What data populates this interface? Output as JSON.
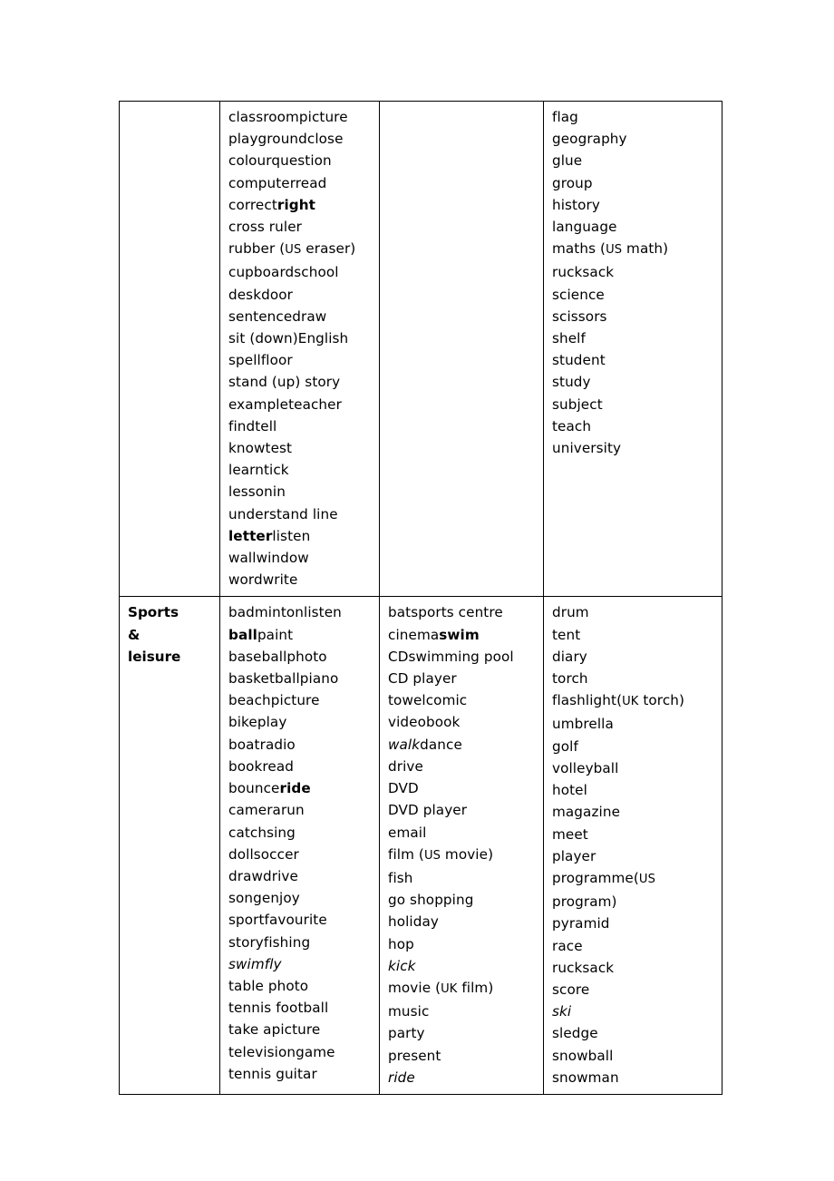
{
  "document": {
    "type": "vocabulary-reference-table",
    "page_background": "#ffffff",
    "text_color": "#000000",
    "border_color": "#000000"
  },
  "table": {
    "columns": 4,
    "rows": [
      {
        "row_id": "row-1-unnamed-category",
        "category": "",
        "col1_words": [],
        "col2_words": [
          {
            "text": "classroompicture",
            "style": "regular"
          },
          {
            "text": "playgroundclose",
            "style": "regular"
          },
          {
            "text": "colourquestion",
            "style": "regular"
          },
          {
            "text": "computerread",
            "style": "regular"
          },
          {
            "text": "correctright",
            "style": "mixed",
            "plain": "correct",
            "bold": "right"
          },
          {
            "text": "cross ruler",
            "style": "regular"
          },
          {
            "text": "rubber (US eraser)",
            "style": "mixed-smallcap",
            "plain": "rubber (",
            "smallcap": "US",
            "plain2": " eraser)"
          },
          {
            "text": "cupboardschool",
            "style": "regular"
          },
          {
            "text": "deskdoor",
            "style": "regular"
          },
          {
            "text": "sentencedraw",
            "style": "regular"
          },
          {
            "text": "sit (down)English",
            "style": "regular"
          },
          {
            "text": "spellfloor",
            "style": "regular"
          },
          {
            "text": "stand (up) story",
            "style": "regular"
          },
          {
            "text": "exampleteacher",
            "style": "regular"
          },
          {
            "text": "findtell",
            "style": "regular"
          },
          {
            "text": "knowtest",
            "style": "regular"
          },
          {
            "text": "learntick",
            "style": "regular"
          },
          {
            "text": "lessonin",
            "style": "regular"
          },
          {
            "text": "understand line",
            "style": "regular"
          },
          {
            "text": "letterlisten",
            "style": "mixed-bold-first",
            "bold": "letter",
            "plain": "listen"
          },
          {
            "text": "wallwindow",
            "style": "regular"
          },
          {
            "text": "wordwrite",
            "style": "regular"
          }
        ],
        "col3_words": [],
        "col4_words": [
          {
            "text": "flag",
            "style": "regular"
          },
          {
            "text": "geography",
            "style": "regular"
          },
          {
            "text": "glue",
            "style": "regular"
          },
          {
            "text": "group",
            "style": "regular"
          },
          {
            "text": "history",
            "style": "regular"
          },
          {
            "text": "language",
            "style": "regular"
          },
          {
            "text": "maths (US math)",
            "style": "mixed-smallcap",
            "plain": "maths (",
            "smallcap": "US",
            "plain2": " math)"
          },
          {
            "text": "rucksack",
            "style": "regular"
          },
          {
            "text": "science",
            "style": "regular"
          },
          {
            "text": "scissors",
            "style": "regular"
          },
          {
            "text": "shelf",
            "style": "regular"
          },
          {
            "text": "student",
            "style": "regular"
          },
          {
            "text": "study",
            "style": "regular"
          },
          {
            "text": "subject",
            "style": "regular"
          },
          {
            "text": "teach",
            "style": "regular"
          },
          {
            "text": "university",
            "style": "regular"
          }
        ]
      },
      {
        "row_id": "row-2-sports-and-leisure",
        "category": "Sports & leisure",
        "category_lines": [
          "Sports",
          "&",
          "leisure"
        ],
        "col2_words": [
          {
            "text": "badmintonlisten",
            "style": "regular"
          },
          {
            "text": "ballpaint",
            "style": "mixed-bold-first",
            "bold": "ball",
            "plain": "paint"
          },
          {
            "text": "baseballphoto",
            "style": "regular"
          },
          {
            "text": "basketballpiano",
            "style": "regular"
          },
          {
            "text": "beachpicture",
            "style": "regular"
          },
          {
            "text": "bikeplay",
            "style": "regular"
          },
          {
            "text": "boatradio",
            "style": "regular"
          },
          {
            "text": "bookread",
            "style": "regular"
          },
          {
            "text": "bounceride",
            "style": "mixed",
            "plain": "bounce",
            "bold": "ride"
          },
          {
            "text": "camerarun",
            "style": "regular"
          },
          {
            "text": "catchsing",
            "style": "regular"
          },
          {
            "text": "dollsoccer",
            "style": "regular"
          },
          {
            "text": "drawdrive",
            "style": "regular"
          },
          {
            "text": "songenjoy",
            "style": "regular"
          },
          {
            "text": "sportfavourite",
            "style": "regular"
          },
          {
            "text": "storyfishing",
            "style": "regular"
          },
          {
            "text": "swimfly",
            "style": "italic"
          },
          {
            "text": "table photo",
            "style": "regular"
          },
          {
            "text": "tennis football",
            "style": "regular"
          },
          {
            "text": "take apicture",
            "style": "regular"
          },
          {
            "text": "televisiongame",
            "style": "regular"
          },
          {
            "text": "tennis guitar",
            "style": "regular"
          }
        ],
        "col3_words": [
          {
            "text": "batsports centre",
            "style": "regular"
          },
          {
            "text": "cinemaswim",
            "style": "mixed",
            "plain": "cinema",
            "bold": "swim"
          },
          {
            "text": "CDswimming pool",
            "style": "regular"
          },
          {
            "text": "CD player",
            "style": "regular"
          },
          {
            "text": "towelcomic",
            "style": "regular"
          },
          {
            "text": "videobook",
            "style": "regular"
          },
          {
            "text": "walkdance",
            "style": "mixed-italic-first",
            "italic": "walk",
            "plain": "dance"
          },
          {
            "text": "drive",
            "style": "regular"
          },
          {
            "text": "DVD",
            "style": "regular"
          },
          {
            "text": "DVD player",
            "style": "regular"
          },
          {
            "text": "email",
            "style": "regular"
          },
          {
            "text": "film (US movie)",
            "style": "mixed-smallcap",
            "plain": "film (",
            "smallcap": "US",
            "plain2": " movie)"
          },
          {
            "text": "fish",
            "style": "regular"
          },
          {
            "text": "go shopping",
            "style": "regular"
          },
          {
            "text": "holiday",
            "style": "regular"
          },
          {
            "text": "hop",
            "style": "regular"
          },
          {
            "text": "kick",
            "style": "italic"
          },
          {
            "text": "movie (UK film)",
            "style": "mixed-smallcap",
            "plain": "movie (",
            "smallcap": "UK",
            "plain2": " film)"
          },
          {
            "text": "music",
            "style": "regular"
          },
          {
            "text": "party",
            "style": "regular"
          },
          {
            "text": "present",
            "style": "regular"
          },
          {
            "text": "ride",
            "style": "italic"
          }
        ],
        "col4_words": [
          {
            "text": "drum",
            "style": "regular"
          },
          {
            "text": "tent",
            "style": "regular"
          },
          {
            "text": "diary",
            "style": "regular"
          },
          {
            "text": "torch",
            "style": "regular"
          },
          {
            "text": "flashlight(UK torch)",
            "style": "mixed-smallcap",
            "plain": "flashlight(",
            "smallcap": "UK",
            "plain2": " torch)"
          },
          {
            "text": "umbrella",
            "style": "regular"
          },
          {
            "text": "golf",
            "style": "regular"
          },
          {
            "text": "volleyball",
            "style": "regular"
          },
          {
            "text": "hotel",
            "style": "regular"
          },
          {
            "text": "magazine",
            "style": "regular"
          },
          {
            "text": "meet",
            "style": "regular"
          },
          {
            "text": "player",
            "style": "regular"
          },
          {
            "text": "programme(US",
            "style": "mixed-smallcap",
            "plain": "programme(",
            "smallcap": "US",
            "plain2": ""
          },
          {
            "text": "program)",
            "style": "regular"
          },
          {
            "text": "pyramid",
            "style": "regular"
          },
          {
            "text": "race",
            "style": "regular"
          },
          {
            "text": "rucksack",
            "style": "regular"
          },
          {
            "text": "score",
            "style": "regular"
          },
          {
            "text": "ski",
            "style": "italic"
          },
          {
            "text": "sledge",
            "style": "regular"
          },
          {
            "text": "snowball",
            "style": "regular"
          },
          {
            "text": "snowman",
            "style": "regular"
          }
        ]
      }
    ]
  }
}
